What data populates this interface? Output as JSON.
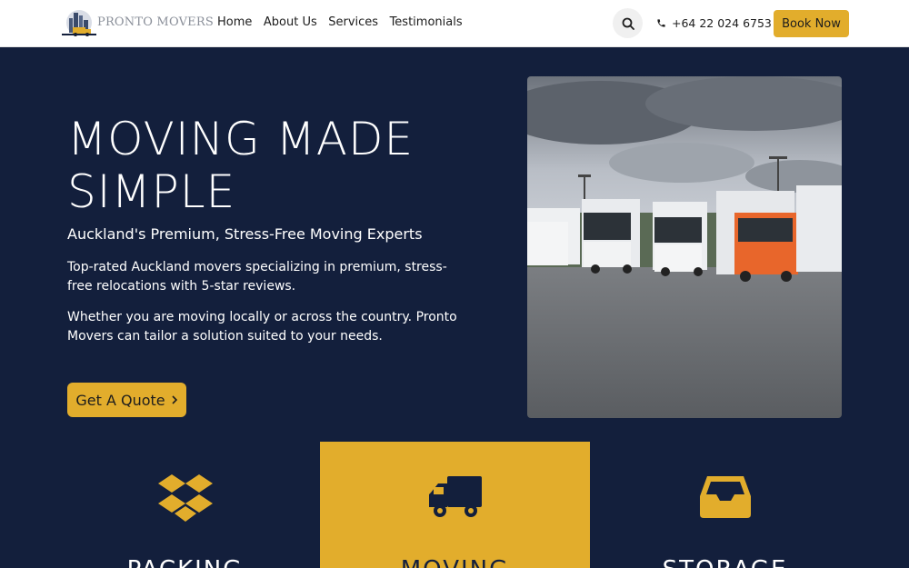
{
  "header": {
    "logo_text": "PRONTO MOVERS",
    "nav": [
      "Home",
      "About Us",
      "Services",
      "Testimonials"
    ],
    "search_icon": "search-icon",
    "phone": "+64 22 024 6753",
    "book_label": "Book Now"
  },
  "hero": {
    "title": "MOVING MADE SIMPLE",
    "subtitle": "Auckland's Premium, Stress-Free Moving Experts",
    "paragraph1": "Top-rated Auckland movers specializing in premium, stress-free relocations with 5-star reviews.",
    "paragraph2": "Whether you are moving locally or across the country. Pronto Movers can tailor a solution suited to your needs.",
    "cta_label": "Get A Quote"
  },
  "services": [
    {
      "label": "PACKING",
      "icon": "dropbox-icon"
    },
    {
      "label": "MOVING",
      "icon": "truck-icon"
    },
    {
      "label": "STORAGE",
      "icon": "inbox-icon"
    }
  ],
  "colors": {
    "navy": "#131f3c",
    "accent": "#e2ad2c",
    "white": "#ffffff"
  }
}
